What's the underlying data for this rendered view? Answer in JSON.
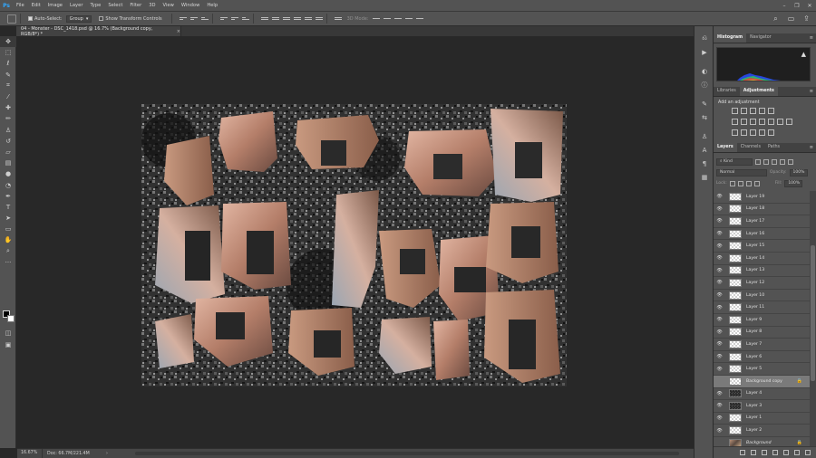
{
  "app": {
    "logo": "Ps",
    "menu": [
      "File",
      "Edit",
      "Image",
      "Layer",
      "Type",
      "Select",
      "Filter",
      "3D",
      "View",
      "Window",
      "Help"
    ],
    "window_controls": [
      "–",
      "❐",
      "✕"
    ]
  },
  "options": {
    "auto_select_label": "Auto-Select:",
    "auto_select_value": "Group",
    "transform_controls_label": "Show Transform Controls",
    "mode_3d_label": "3D Mode:"
  },
  "document": {
    "tab_title": "04 - Monster - DSC_1418.psd @ 16.7% (Background copy, RGB/8*) *",
    "close": "×"
  },
  "status": {
    "zoom": "16.67%",
    "doc_size": "Doc: 66.7M/221.4M",
    "arrow": "›"
  },
  "panels": {
    "histogram_tabs": [
      "Histogram",
      "Navigator"
    ],
    "adjust_tabs": [
      "Libraries",
      "Adjustments"
    ],
    "adjust_title": "Add an adjustment",
    "layers_tabs": [
      "Layers",
      "Channels",
      "Paths"
    ],
    "kind_filter": "Kind",
    "blend_mode": "Normal",
    "opacity_label": "Opacity:",
    "opacity_value": "100%",
    "lock_label": "Lock:",
    "fill_label": "Fill:",
    "fill_value": "100%",
    "menu_glyph": "≡",
    "warning_glyph": "▲"
  },
  "layers": [
    {
      "name": "Layer 19",
      "visible": true,
      "thumb": "transparent"
    },
    {
      "name": "Layer 18",
      "visible": true,
      "thumb": "transparent"
    },
    {
      "name": "Layer 17",
      "visible": true,
      "thumb": "transparent"
    },
    {
      "name": "Layer 16",
      "visible": true,
      "thumb": "transparent"
    },
    {
      "name": "Layer 15",
      "visible": true,
      "thumb": "transparent"
    },
    {
      "name": "Layer 14",
      "visible": true,
      "thumb": "transparent"
    },
    {
      "name": "Layer 13",
      "visible": true,
      "thumb": "transparent"
    },
    {
      "name": "Layer 12",
      "visible": true,
      "thumb": "transparent"
    },
    {
      "name": "Layer 10",
      "visible": true,
      "thumb": "transparent"
    },
    {
      "name": "Layer 11",
      "visible": true,
      "thumb": "transparent"
    },
    {
      "name": "Layer 9",
      "visible": true,
      "thumb": "transparent"
    },
    {
      "name": "Layer 8",
      "visible": true,
      "thumb": "transparent"
    },
    {
      "name": "Layer 7",
      "visible": true,
      "thumb": "transparent"
    },
    {
      "name": "Layer 6",
      "visible": true,
      "thumb": "transparent"
    },
    {
      "name": "Layer 5",
      "visible": true,
      "thumb": "transparent"
    },
    {
      "name": "Background copy",
      "visible": false,
      "thumb": "transparent",
      "selected": true,
      "locked": true
    },
    {
      "name": "Layer 4",
      "visible": true,
      "thumb": "dark"
    },
    {
      "name": "Layer 3",
      "visible": true,
      "thumb": "dark"
    },
    {
      "name": "Layer 1",
      "visible": true,
      "thumb": "transparent"
    },
    {
      "name": "Layer 2",
      "visible": true,
      "thumb": "transparent"
    },
    {
      "name": "Background",
      "visible": false,
      "thumb": "photo",
      "locked": true,
      "italic": true
    }
  ],
  "colors": {
    "ui_dark": "#282828",
    "ui_mid": "#535353",
    "accent": "#31a8ff"
  }
}
